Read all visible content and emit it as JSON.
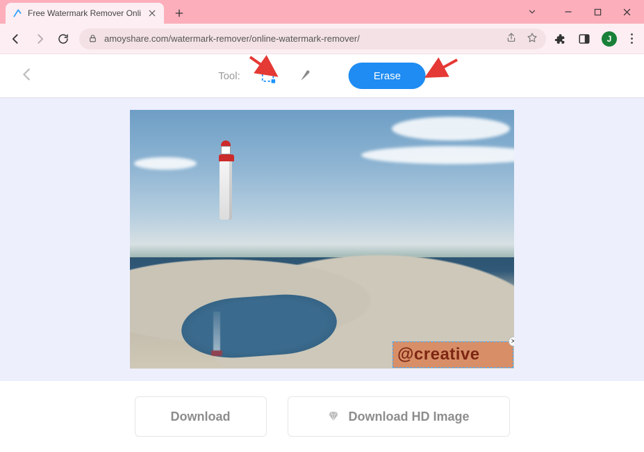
{
  "browser": {
    "tab_title": "Free Watermark Remover Onli",
    "url": "amoyshare.com/watermark-remover/online-watermark-remover/",
    "avatar_initial": "J"
  },
  "toolbar": {
    "tool_label": "Tool:",
    "erase_label": "Erase"
  },
  "watermark": {
    "text": "@creative"
  },
  "actions": {
    "download_label": "Download",
    "download_hd_label": "Download HD Image"
  }
}
